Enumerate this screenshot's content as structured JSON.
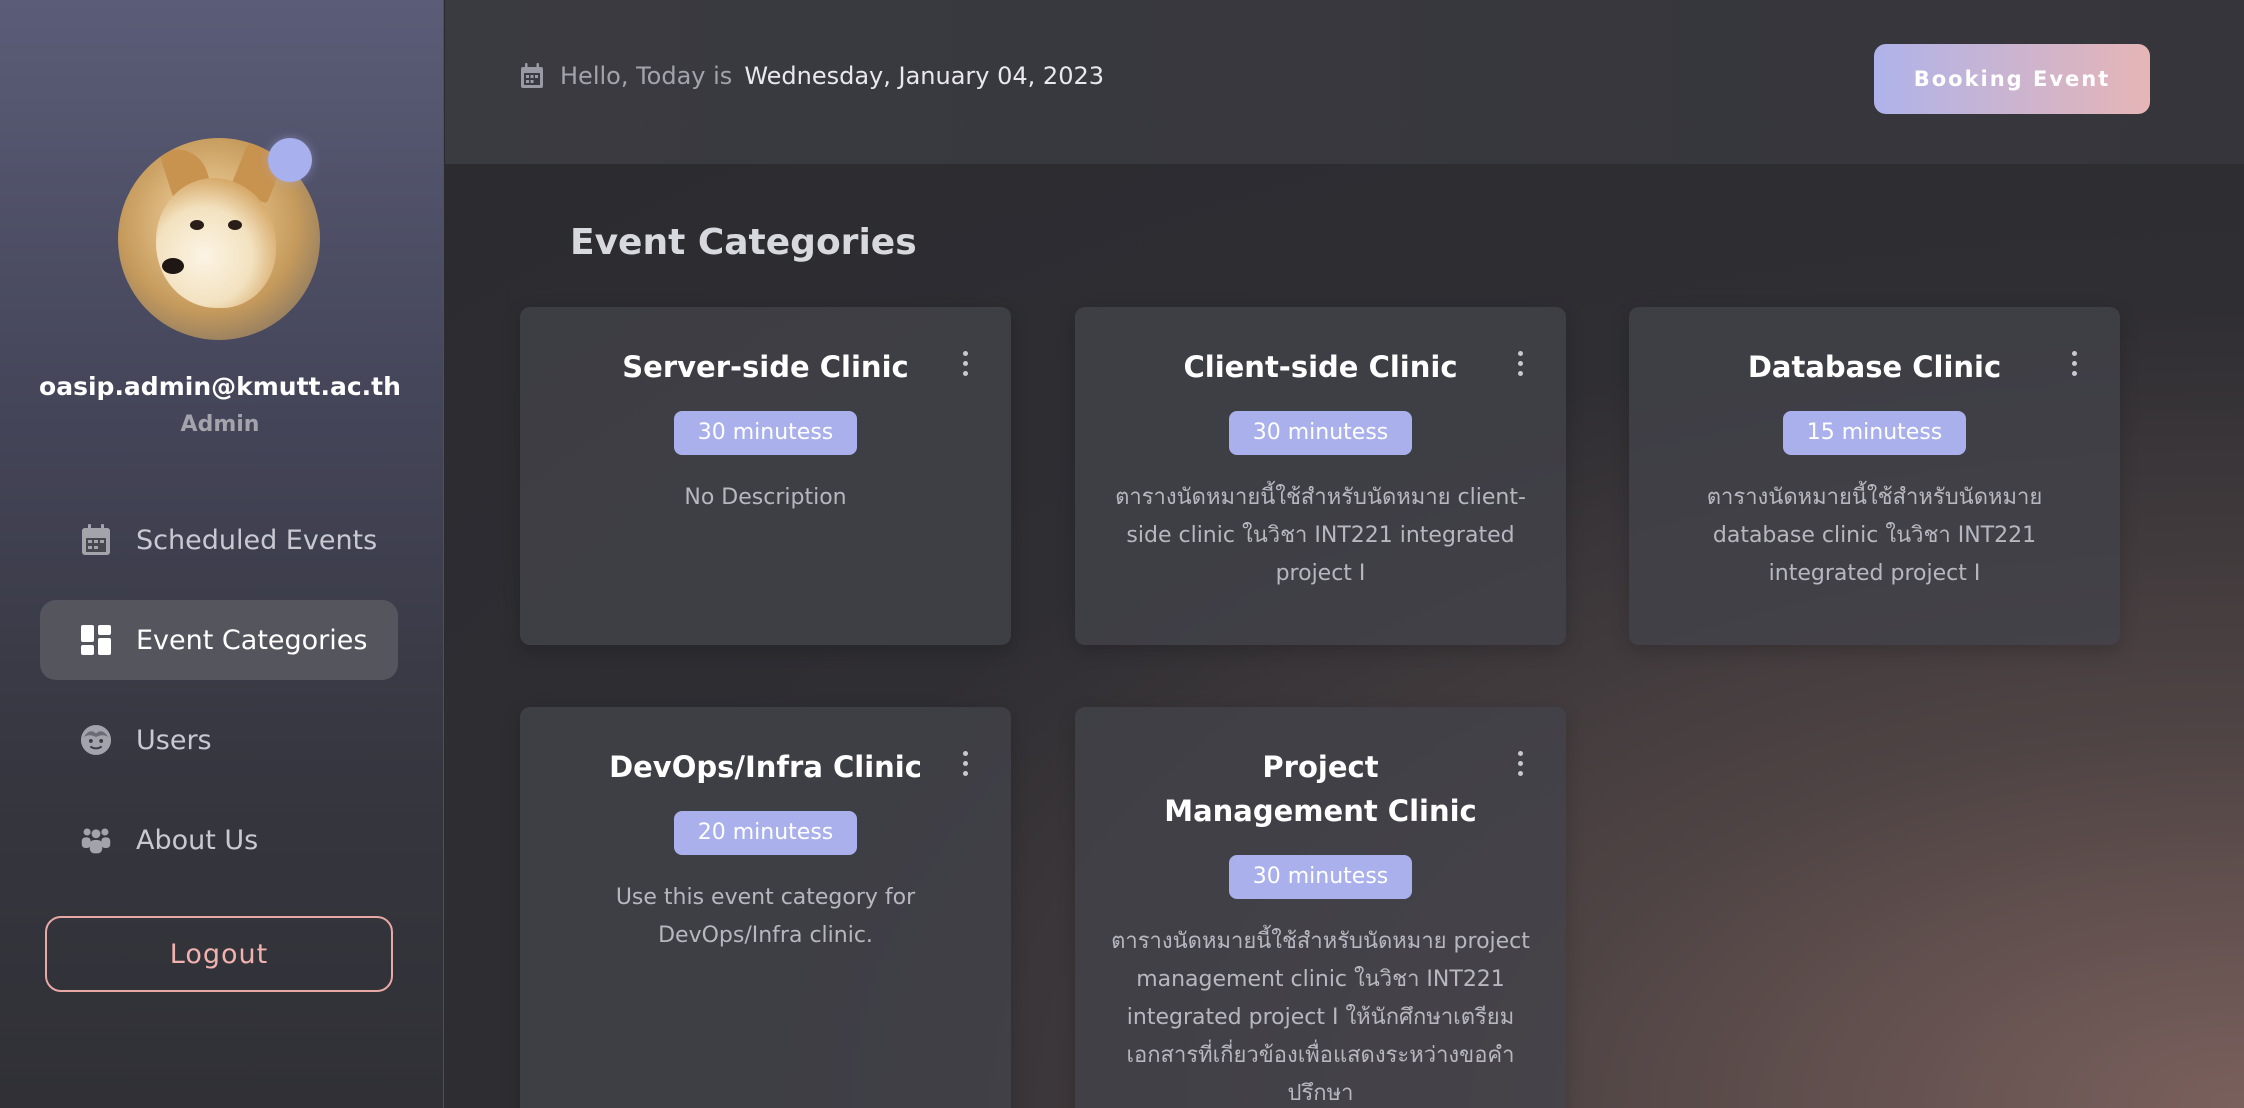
{
  "sidebar": {
    "user_email": "oasip.admin@kmutt.ac.th",
    "user_role": "Admin",
    "nav": [
      {
        "label": "Scheduled Events",
        "icon": "calendar-icon",
        "active": false
      },
      {
        "label": "Event Categories",
        "icon": "dashboard-icon",
        "active": true
      },
      {
        "label": "Users",
        "icon": "user-face-icon",
        "active": false
      },
      {
        "label": "About Us",
        "icon": "group-icon",
        "active": false
      }
    ],
    "logout_label": "Logout"
  },
  "header": {
    "greeting": "Hello, Today is",
    "date": "Wednesday, January 04, 2023",
    "booking_label": "Booking Event"
  },
  "main": {
    "title": "Event Categories",
    "cards": [
      {
        "title": "Server-side Clinic",
        "duration": "30 minutess",
        "description": "No Description"
      },
      {
        "title": "Client-side Clinic",
        "duration": "30 minutess",
        "description": "ตารางนัดหมายนี้ใช้สำหรับนัดหมาย client-side clinic ในวิชา INT221 integrated project I"
      },
      {
        "title": "Database Clinic",
        "duration": "15 minutess",
        "description": "ตารางนัดหมายนี้ใช้สำหรับนัดหมาย database clinic ในวิชา INT221 integrated project I"
      },
      {
        "title": "DevOps/Infra Clinic",
        "duration": "20 minutess",
        "description": "Use this event category for DevOps/Infra clinic."
      },
      {
        "title": "Project Management Clinic",
        "duration": "30 minutess",
        "description": "ตารางนัดหมายนี้ใช้สำหรับนัดหมาย project management clinic ในวิชา INT221 integrated project I ให้นักศึกษาเตรียมเอกสารที่เกี่ยวข้องเพื่อแสดงระหว่างขอคำปรึกษา"
      }
    ]
  },
  "colors": {
    "accent": "#a9b0ec",
    "logout_border": "#e8a8a6",
    "booking_gradient_start": "#afb3ea",
    "booking_gradient_end": "#e6b5b6"
  }
}
